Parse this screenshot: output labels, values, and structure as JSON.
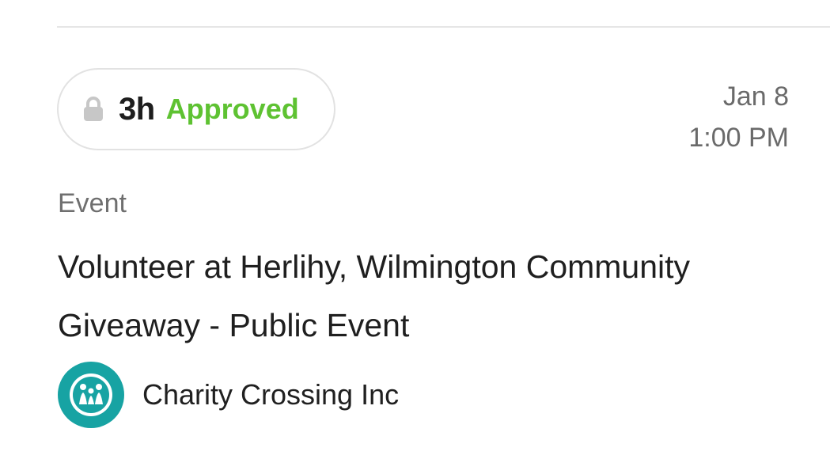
{
  "status": {
    "hours": "3h",
    "label": "Approved",
    "lock_icon": "lock-icon",
    "accent_color": "#5ec232"
  },
  "schedule": {
    "date": "Jan 8",
    "time": "1:00 PM"
  },
  "event": {
    "category": "Event",
    "title": "Volunteer at Herlihy, Wilmington Community Giveaway - Public Event"
  },
  "organization": {
    "name": "Charity Crossing Inc",
    "logo_icon": "charity-crossing-logo",
    "brand_color": "#17a3a3"
  }
}
